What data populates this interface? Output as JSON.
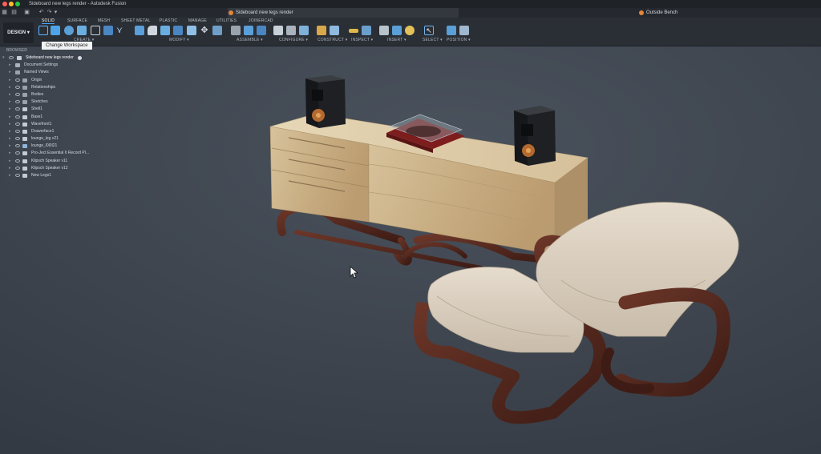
{
  "window": {
    "title": "Sideboard new legs render - Autodesk Fusion",
    "colors": {
      "close": "#ff5f57",
      "minimize": "#febc2e",
      "maximize": "#28c840"
    }
  },
  "doc_tabs": [
    {
      "label": "Sideboard new legs render",
      "active": true
    },
    {
      "label": "Outside Bench",
      "active": false
    }
  ],
  "toolbar": {
    "workspace_label": "DESIGN",
    "tabs": [
      "SOLID",
      "SURFACE",
      "MESH",
      "SHEET METAL",
      "PLASTIC",
      "MANAGE",
      "UTILITIES",
      "JOINERCAD"
    ],
    "active_tab": "SOLID",
    "groups": [
      "CREATE",
      "MODIFY",
      "ASSEMBLE",
      "CONFIGURE",
      "CONSTRUCT",
      "INSPECT",
      "INSERT",
      "SELECT",
      "POSITION"
    ],
    "accent_color": "#4aa3ff"
  },
  "tooltip": {
    "text": "Change Workspace"
  },
  "browser": {
    "header": "BROWSER",
    "root": "Sideboard new legs render",
    "items": [
      {
        "label": "Document Settings",
        "icon": "gear-icon"
      },
      {
        "label": "Named Views",
        "icon": "folder-icon"
      },
      {
        "label": "Origin",
        "icon": "folder-icon"
      },
      {
        "label": "Relationships",
        "icon": "folder-icon"
      },
      {
        "label": "Bodies",
        "icon": "folder-icon"
      },
      {
        "label": "Sketches",
        "icon": "folder-icon"
      },
      {
        "label": "Shell1",
        "icon": "component-icon"
      },
      {
        "label": "Base1",
        "icon": "component-icon"
      },
      {
        "label": "Wavefront1",
        "icon": "component-icon"
      },
      {
        "label": "Drawerface1",
        "icon": "component-icon"
      },
      {
        "label": "lounge_leg v21",
        "icon": "component-icon"
      },
      {
        "label": "lounge_l0l0l21",
        "icon": "link-icon"
      },
      {
        "label": "Pro-Ject Essential II Record Pl...",
        "icon": "component-icon"
      },
      {
        "label": "Klipsch Speaker v11",
        "icon": "component-icon"
      },
      {
        "label": "Klipsch Speaker v12",
        "icon": "component-icon"
      },
      {
        "label": "New Legs1",
        "icon": "component-icon"
      }
    ]
  }
}
